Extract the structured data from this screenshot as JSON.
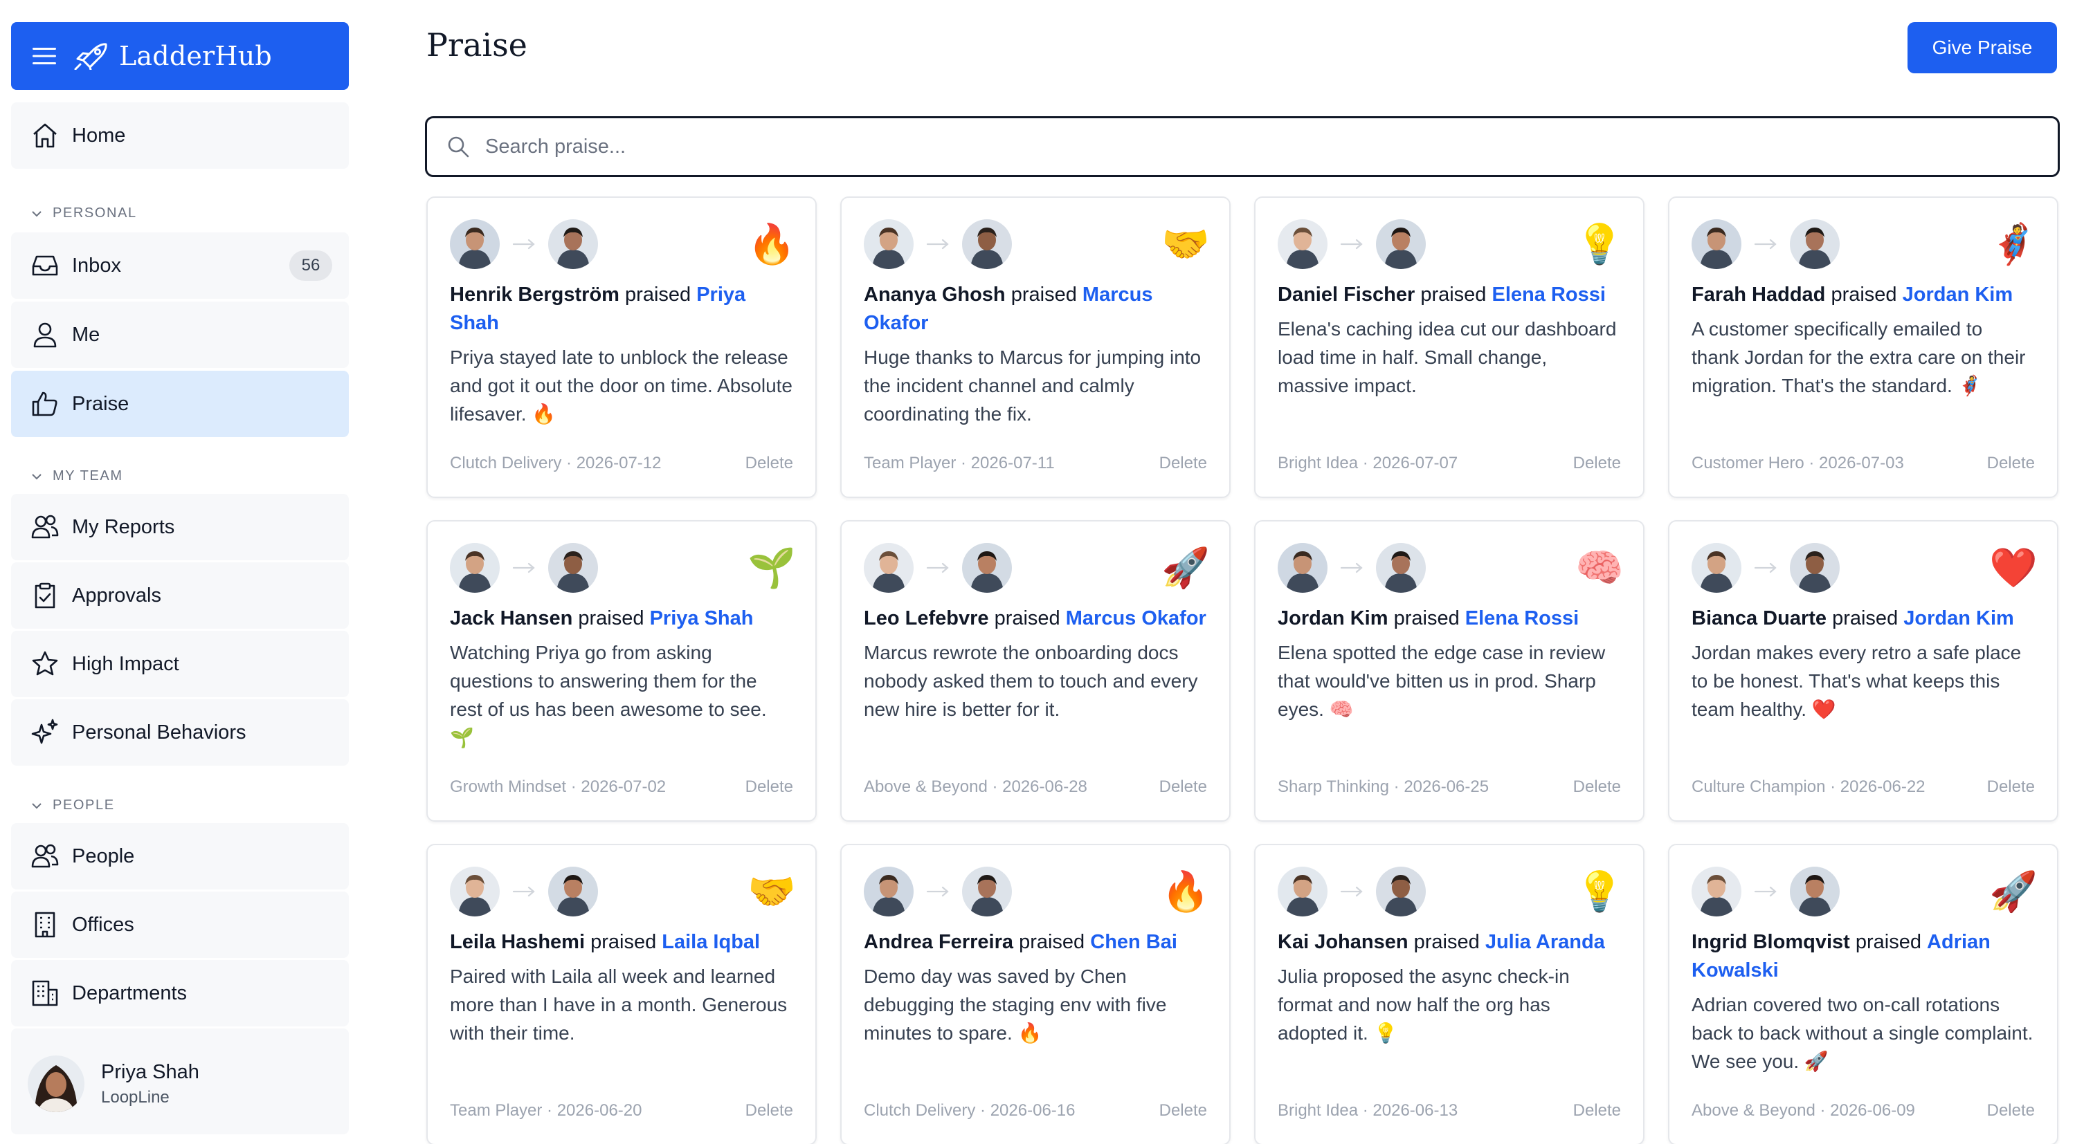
{
  "app": {
    "name": "LadderHub"
  },
  "nav": {
    "home": "Home",
    "sections": {
      "personal": "PERSONAL",
      "my_team": "MY TEAM",
      "people": "PEOPLE"
    },
    "inbox": "Inbox",
    "inbox_count": "56",
    "me": "Me",
    "praise": "Praise",
    "my_reports": "My Reports",
    "approvals": "Approvals",
    "high_impact": "High Impact",
    "personal_behaviors": "Personal Behaviors",
    "people": "People",
    "offices": "Offices",
    "departments": "Departments"
  },
  "user": {
    "name": "Priya Shah",
    "org": "LoopLine"
  },
  "page": {
    "title": "Praise",
    "give_button": "Give Praise"
  },
  "search": {
    "placeholder": "Search praise...",
    "value": ""
  },
  "praised_word": "praised",
  "delete_label": "Delete",
  "colors": {
    "accent": "#1d5ff0",
    "active_nav": "#dcebfd",
    "nav_bg": "#f7f8fa"
  },
  "cards": [
    {
      "giver": "Henrik Bergström",
      "receiver": "Priya Shah",
      "message": "Priya stayed late to unblock the release and got it out the door on time. Absolute lifesaver. 🔥",
      "emoji": "🔥",
      "icon": "fire-icon",
      "meta": "Clutch Delivery · 2026-07-12"
    },
    {
      "giver": "Ananya Ghosh",
      "receiver": "Marcus Okafor",
      "message": "Huge thanks to Marcus for jumping into the incident channel and calmly coordinating the fix.",
      "emoji": "🤝",
      "icon": "handshake-icon",
      "meta": "Team Player · 2026-07-11"
    },
    {
      "giver": "Daniel Fischer",
      "receiver": "Elena Rossi",
      "message": "Elena's caching idea cut our dashboard load time in half. Small change, massive impact.",
      "emoji": "💡",
      "icon": "lightbulb-icon",
      "meta": "Bright Idea · 2026-07-07"
    },
    {
      "giver": "Farah Haddad",
      "receiver": "Jordan Kim",
      "message": "A customer specifically emailed to thank Jordan for the extra care on their migration. That's the standard. 🦸",
      "emoji": "🦸",
      "icon": "superhero-icon",
      "meta": "Customer Hero · 2026-07-03"
    },
    {
      "giver": "Jack Hansen",
      "receiver": "Priya Shah",
      "message": "Watching Priya go from asking questions to answering them for the rest of us has been awesome to see. 🌱",
      "emoji": "🌱",
      "icon": "seedling-icon",
      "meta": "Growth Mindset · 2026-07-02"
    },
    {
      "giver": "Leo Lefebvre",
      "receiver": "Marcus Okafor",
      "message": "Marcus rewrote the onboarding docs nobody asked them to touch and every new hire is better for it.",
      "emoji": "🚀",
      "icon": "rocket-icon",
      "meta": "Above & Beyond · 2026-06-28"
    },
    {
      "giver": "Jordan Kim",
      "receiver": "Elena Rossi",
      "message": "Elena spotted the edge case in review that would've bitten us in prod. Sharp eyes. 🧠",
      "emoji": "🧠",
      "icon": "brain-icon",
      "meta": "Sharp Thinking · 2026-06-25"
    },
    {
      "giver": "Bianca Duarte",
      "receiver": "Jordan Kim",
      "message": "Jordan makes every retro a safe place to be honest. That's what keeps this team healthy. ❤️",
      "emoji": "❤️",
      "icon": "heart-icon",
      "meta": "Culture Champion · 2026-06-22"
    },
    {
      "giver": "Leila Hashemi",
      "receiver": "Laila Iqbal",
      "message": "Paired with Laila all week and learned more than I have in a month. Generous with their time.",
      "emoji": "🤝",
      "icon": "handshake-icon",
      "meta": "Team Player · 2026-06-20"
    },
    {
      "giver": "Andrea Ferreira",
      "receiver": "Chen Bai",
      "message": "Demo day was saved by Chen debugging the staging env with five minutes to spare. 🔥",
      "emoji": "🔥",
      "icon": "fire-icon",
      "meta": "Clutch Delivery · 2026-06-16"
    },
    {
      "giver": "Kai Johansen",
      "receiver": "Julia Aranda",
      "message": "Julia proposed the async check-in format and now half the org has adopted it. 💡",
      "emoji": "💡",
      "icon": "lightbulb-icon",
      "meta": "Bright Idea · 2026-06-13"
    },
    {
      "giver": "Ingrid Blomqvist",
      "receiver": "Adrian Kowalski",
      "message": "Adrian covered two on-call rotations back to back without a single complaint. We see you. 🚀",
      "emoji": "🚀",
      "icon": "rocket-icon",
      "meta": "Above & Beyond · 2026-06-09"
    }
  ]
}
